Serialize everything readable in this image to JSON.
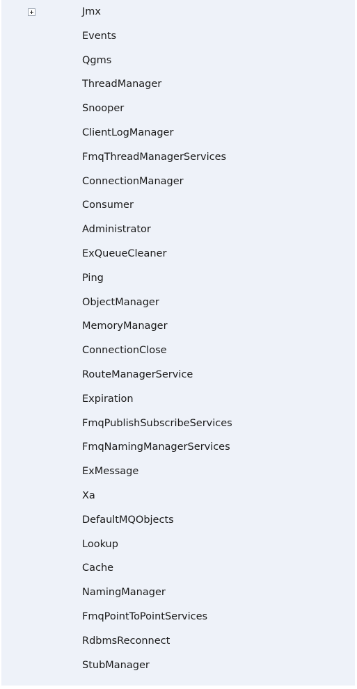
{
  "tree": {
    "items": [
      {
        "label": "Jmx",
        "expandable": true,
        "icon": "plus-expand-icon"
      },
      {
        "label": "Events"
      },
      {
        "label": "Qgms"
      },
      {
        "label": "ThreadManager"
      },
      {
        "label": "Snooper"
      },
      {
        "label": "ClientLogManager"
      },
      {
        "label": "FmqThreadManagerServices"
      },
      {
        "label": "ConnectionManager"
      },
      {
        "label": "Consumer"
      },
      {
        "label": "Administrator"
      },
      {
        "label": "ExQueueCleaner"
      },
      {
        "label": "Ping"
      },
      {
        "label": "ObjectManager"
      },
      {
        "label": "MemoryManager"
      },
      {
        "label": "ConnectionClose"
      },
      {
        "label": "RouteManagerService"
      },
      {
        "label": "Expiration"
      },
      {
        "label": "FmqPublishSubscribeServices"
      },
      {
        "label": "FmqNamingManagerServices"
      },
      {
        "label": "ExMessage"
      },
      {
        "label": "Xa"
      },
      {
        "label": "DefaultMQObjects"
      },
      {
        "label": "Lookup"
      },
      {
        "label": "Cache"
      },
      {
        "label": "NamingManager"
      },
      {
        "label": "FmqPointToPointServices"
      },
      {
        "label": "RdbmsReconnect"
      },
      {
        "label": "StubManager"
      }
    ]
  },
  "colors": {
    "panel_background": "#eef2f9",
    "text": "#1a1a1a"
  }
}
